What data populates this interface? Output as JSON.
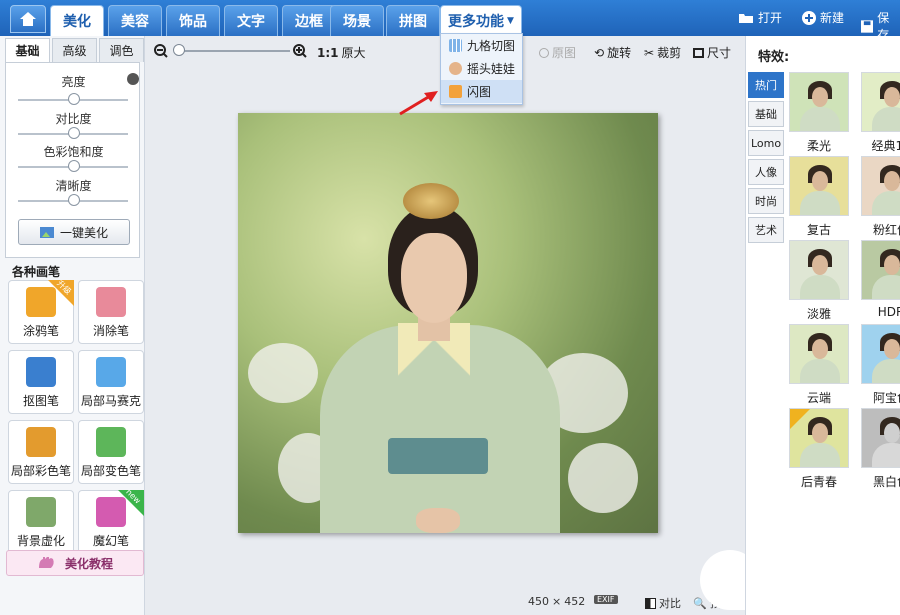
{
  "top_tabs": [
    "美化",
    "美容",
    "饰品",
    "文字",
    "边框",
    "场景",
    "拼图"
  ],
  "more_tab": "更多功能",
  "top_actions": {
    "open": "打开",
    "new": "新建",
    "save": "保存"
  },
  "dropdown_items": [
    "九格切图",
    "摇头娃娃",
    "闪图"
  ],
  "left_tabs": [
    "基础",
    "高级",
    "调色"
  ],
  "sliders": [
    {
      "label": "亮度",
      "value": 0.5
    },
    {
      "label": "对比度",
      "value": 0.5
    },
    {
      "label": "色彩饱和度",
      "value": 0.5
    },
    {
      "label": "清晰度",
      "value": 0.5
    }
  ],
  "one_key_button": "一键美化",
  "brushes_title": "各种画笔",
  "brushes": [
    {
      "label": "涂鸦笔",
      "color": "#f0a62a",
      "badge": "升级"
    },
    {
      "label": "消除笔",
      "color": "#e88a9a",
      "badge": ""
    },
    {
      "label": "抠图笔",
      "color": "#3a7fcf",
      "badge": ""
    },
    {
      "label": "局部马赛克",
      "color": "#58a8e8",
      "badge": ""
    },
    {
      "label": "局部彩色笔",
      "color": "#e39b2e",
      "badge": ""
    },
    {
      "label": "局部变色笔",
      "color": "#5db65a",
      "badge": ""
    },
    {
      "label": "背景虚化",
      "color": "#7fa86a",
      "badge": ""
    },
    {
      "label": "魔幻笔",
      "color": "#d45bb0",
      "badge": "new"
    }
  ],
  "tutorial_label": "美化教程",
  "toolbar": {
    "zoom_1to1": "1:1",
    "original_size": "原大",
    "original_image": "原图",
    "rotate": "旋转",
    "crop": "裁剪",
    "size": "尺寸"
  },
  "status": {
    "width": "450",
    "times": "×",
    "height": "452",
    "exif": "EXIF",
    "compare": "对比",
    "preview": "预览"
  },
  "effects_title": "特效:",
  "effect_categories": [
    "热门",
    "基础",
    "Lomo",
    "人像",
    "时尚",
    "艺术"
  ],
  "effects": [
    {
      "label": "柔光",
      "tint": "#cfe3b8"
    },
    {
      "label": "经典1o",
      "tint": "#e2edc6"
    },
    {
      "label": "复古",
      "tint": "#e7df9a"
    },
    {
      "label": "粉红佳",
      "tint": "#ead7c4"
    },
    {
      "label": "淡雅",
      "tint": "#dfe6d4"
    },
    {
      "label": "HDR",
      "tint": "#b9c9a2"
    },
    {
      "label": "云端",
      "tint": "#dde8c3"
    },
    {
      "label": "阿宝色",
      "tint": "#9fd2ee"
    },
    {
      "label": "后青春",
      "tint": "#dfe49e"
    },
    {
      "label": "黑白色",
      "tint": "#bdbdbd"
    }
  ]
}
